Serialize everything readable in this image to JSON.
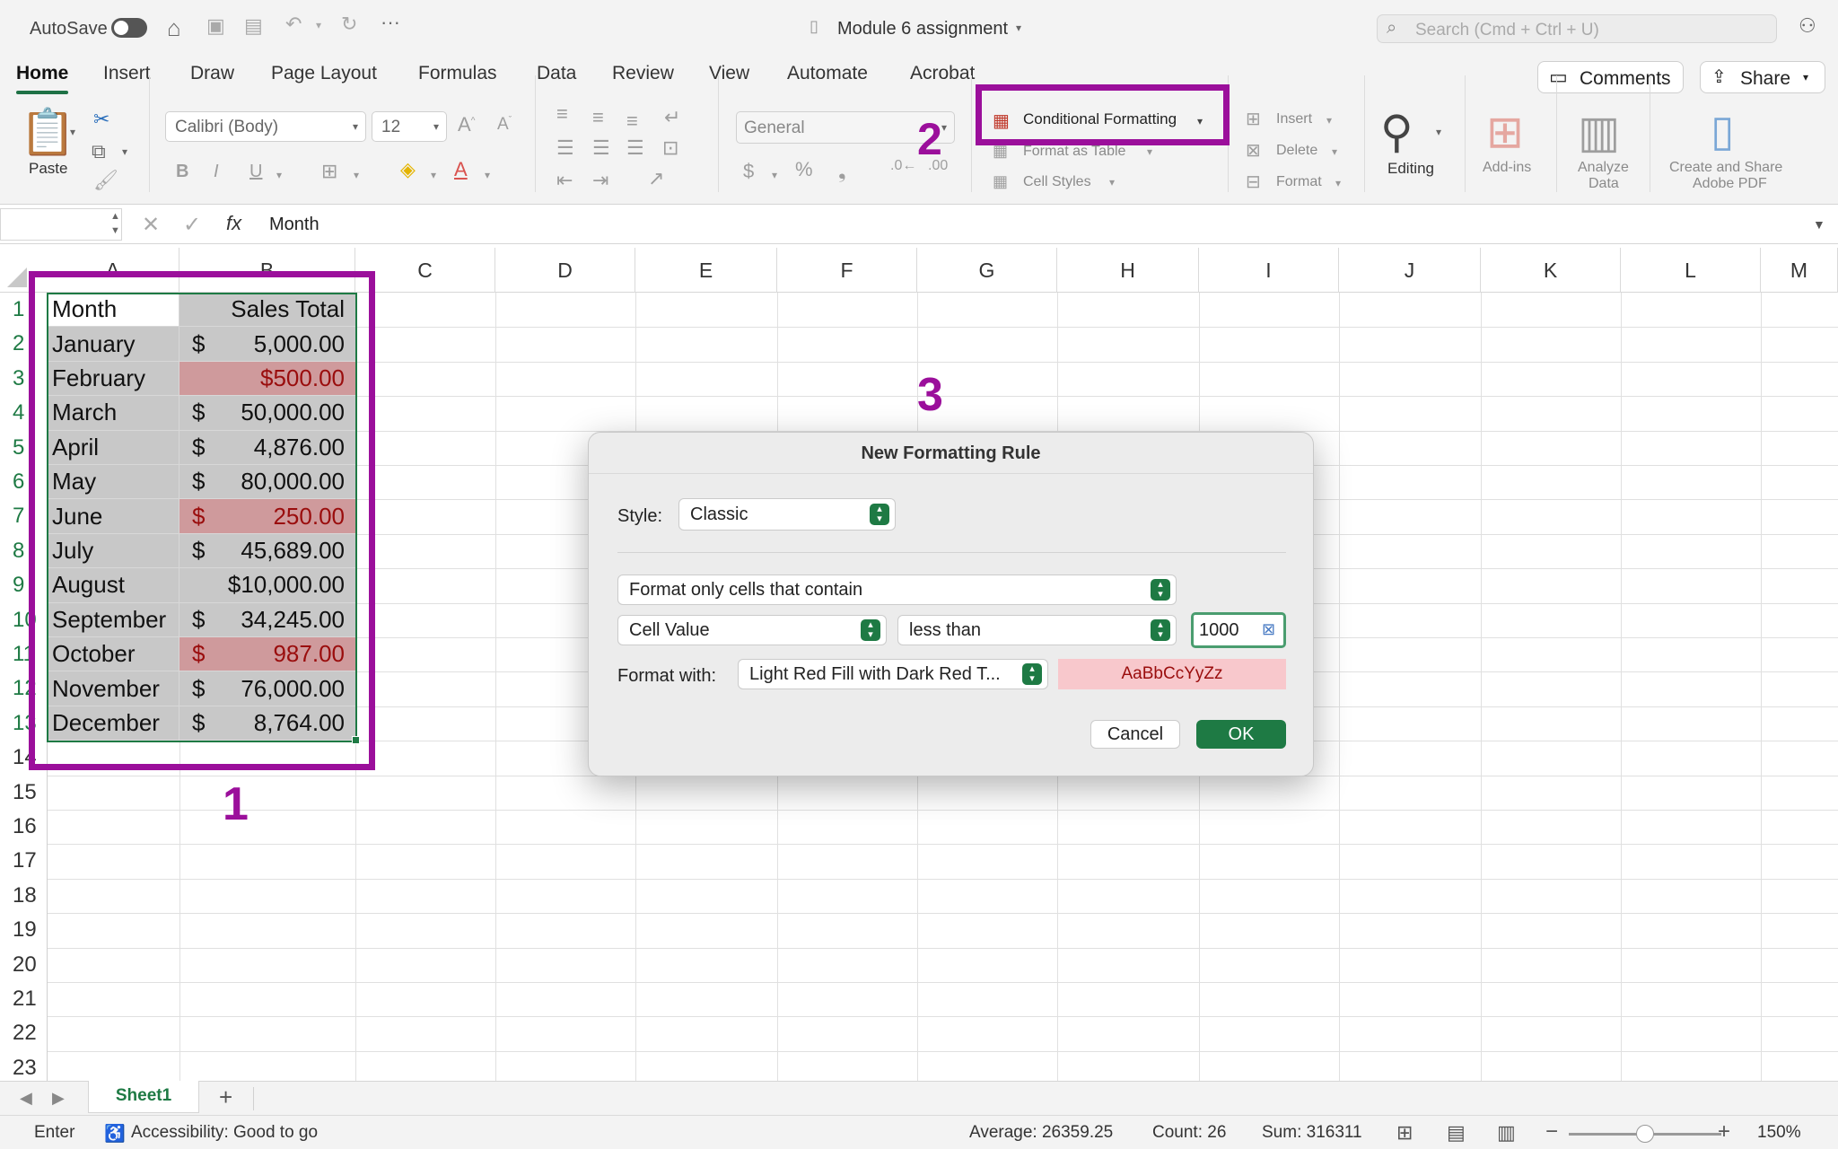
{
  "titlebar": {
    "autosave_label": "AutoSave",
    "doc_title": "Module 6 assignment",
    "search_placeholder": "Search (Cmd + Ctrl + U)"
  },
  "tabs": [
    "Home",
    "Insert",
    "Draw",
    "Page Layout",
    "Formulas",
    "Data",
    "Review",
    "View",
    "Automate",
    "Acrobat"
  ],
  "header_buttons": {
    "comments": "Comments",
    "share": "Share"
  },
  "ribbon": {
    "paste": "Paste",
    "font_name": "Calibri (Body)",
    "font_size": "12",
    "number_format": "General",
    "conditional_formatting": "Conditional Formatting",
    "format_as_table": "Format as Table",
    "cell_styles": "Cell Styles",
    "insert": "Insert",
    "delete": "Delete",
    "format": "Format",
    "editing": "Editing",
    "addins": "Add-ins",
    "analyze_data_1": "Analyze",
    "analyze_data_2": "Data",
    "create_pdf_1": "Create and Share",
    "create_pdf_2": "Adobe PDF",
    "bold": "B",
    "italic": "I",
    "underline": "U"
  },
  "formula_bar": {
    "fx": "fx",
    "content": "Month"
  },
  "columns": [
    "A",
    "B",
    "C",
    "D",
    "E",
    "F",
    "G",
    "H",
    "I",
    "J",
    "K",
    "L",
    "M"
  ],
  "rows": [
    "1",
    "2",
    "3",
    "4",
    "5",
    "6",
    "7",
    "8",
    "9",
    "10",
    "11",
    "12",
    "13",
    "14",
    "15",
    "16",
    "17",
    "18",
    "19",
    "20",
    "21",
    "22",
    "23"
  ],
  "table": [
    {
      "month": "Month",
      "dollar": "",
      "value": "Sales Total",
      "red": false,
      "header": true
    },
    {
      "month": "January",
      "dollar": "$",
      "value": "5,000.00",
      "red": false
    },
    {
      "month": "February",
      "dollar": "",
      "value": "$500.00",
      "red": true
    },
    {
      "month": "March",
      "dollar": "$",
      "value": "50,000.00",
      "red": false
    },
    {
      "month": "April",
      "dollar": "$",
      "value": "4,876.00",
      "red": false
    },
    {
      "month": "May",
      "dollar": "$",
      "value": "80,000.00",
      "red": false
    },
    {
      "month": "June",
      "dollar": "$",
      "value": "250.00",
      "red": true
    },
    {
      "month": "July",
      "dollar": "$",
      "value": "45,689.00",
      "red": false
    },
    {
      "month": "August",
      "dollar": "",
      "value": "$10,000.00",
      "red": false
    },
    {
      "month": "September",
      "dollar": "$",
      "value": "34,245.00",
      "red": false
    },
    {
      "month": "October",
      "dollar": "$",
      "value": "987.00",
      "red": true
    },
    {
      "month": "November",
      "dollar": "$",
      "value": "76,000.00",
      "red": false
    },
    {
      "month": "December",
      "dollar": "$",
      "value": "8,764.00",
      "red": false
    }
  ],
  "annotations": {
    "one": "1",
    "two": "2",
    "three": "3"
  },
  "dialog": {
    "title": "New Formatting Rule",
    "style_label": "Style:",
    "style_value": "Classic",
    "rule_type": "Format only cells that contain",
    "condition_field": "Cell Value",
    "operator": "less than",
    "threshold": "1000",
    "format_with_label": "Format with:",
    "format_with_value": "Light Red Fill with Dark Red T...",
    "preview": "AaBbCcYyZz",
    "cancel": "Cancel",
    "ok": "OK"
  },
  "sheet": {
    "tab": "Sheet1",
    "add": "+"
  },
  "status": {
    "mode": "Enter",
    "accessibility": "Accessibility: Good to go",
    "average": "Average: 26359.25",
    "count": "Count: 26",
    "sum": "Sum: 316311",
    "zoom": "150%",
    "zoom_level": 0.5
  },
  "colors": {
    "accent": "#1e7a44",
    "highlight": "#9b0f9b",
    "red_fill": "#cf9a9c",
    "red_text": "#9a0d0d"
  }
}
